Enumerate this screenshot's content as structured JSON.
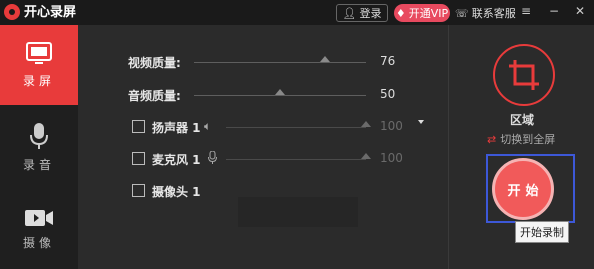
{
  "app": {
    "title": "开心录屏"
  },
  "titlebar": {
    "login_label": "登录",
    "vip_label": "开通VIP",
    "support_label": "联系客服"
  },
  "sidebar": {
    "items": [
      {
        "label": "录屏",
        "icon": "monitor-icon",
        "active": true
      },
      {
        "label": "录音",
        "icon": "microphone-icon",
        "active": false
      },
      {
        "label": "摄像",
        "icon": "camera-icon",
        "active": false
      }
    ]
  },
  "settings": {
    "video_quality": {
      "label": "视频质量:",
      "value": "76",
      "level": 76
    },
    "audio_quality": {
      "label": "音频质量:",
      "value": "50",
      "level": 50
    },
    "speaker": {
      "label": "扬声器 1",
      "value": "100",
      "level": 100,
      "checked": false
    },
    "microphone": {
      "label": "麦克风 1",
      "value": "100",
      "level": 100,
      "checked": false
    },
    "camera": {
      "label": "摄像头 1",
      "checked": false
    }
  },
  "right_panel": {
    "area_label": "区域",
    "fullscreen_label": "切换到全屏",
    "start_label": "开始",
    "tooltip": "开始录制"
  },
  "colors": {
    "accent": "#e83b3b",
    "start_button": "#f15a5a",
    "focus_frame": "#3d58d8",
    "background": "#2b2b2b"
  }
}
